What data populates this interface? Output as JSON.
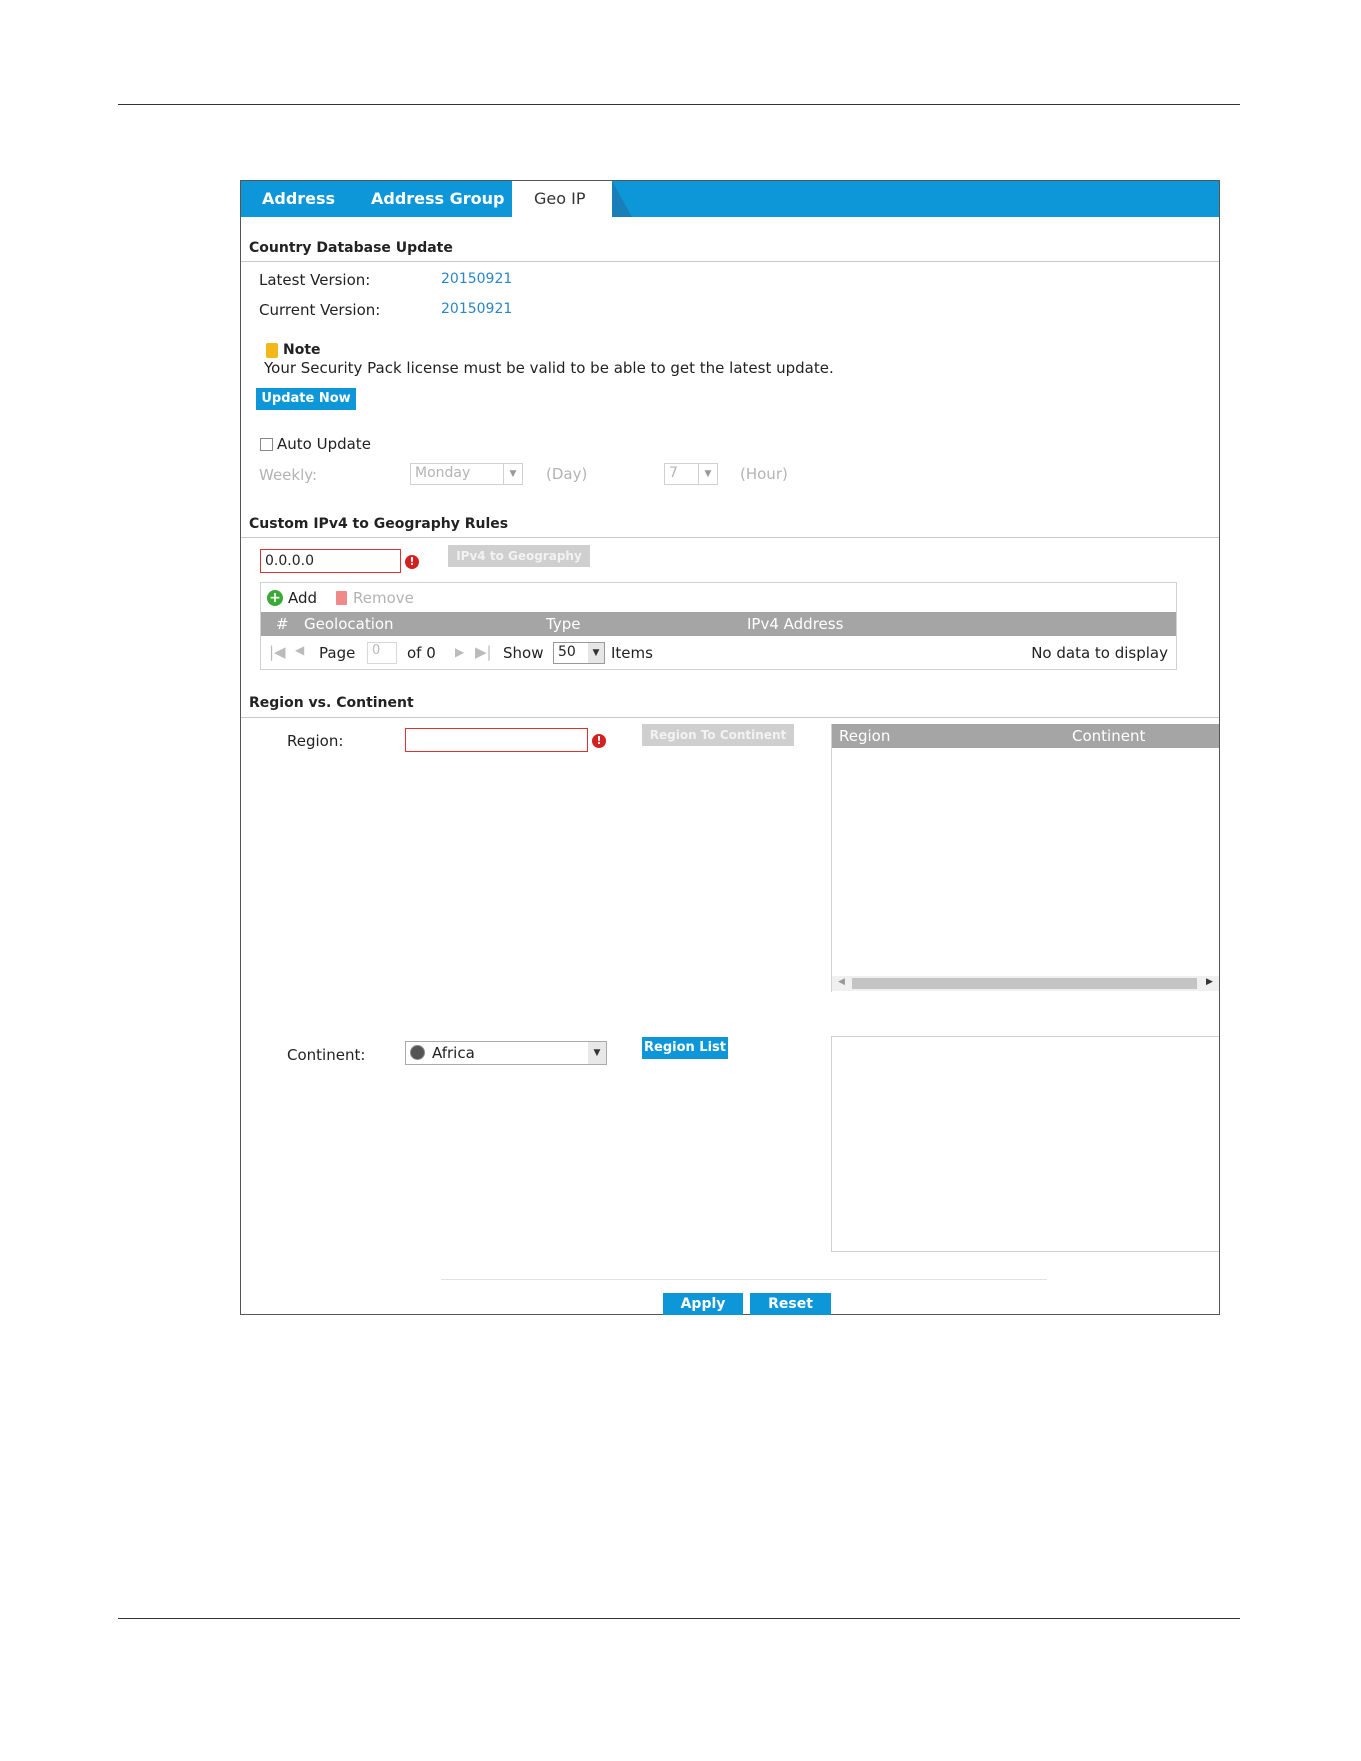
{
  "tabs": [
    {
      "label": "Address"
    },
    {
      "label": "Address Group"
    },
    {
      "label": "Geo IP"
    }
  ],
  "country_db": {
    "title": "Country Database Update",
    "latest_label": "Latest Version:",
    "latest_value": "20150921",
    "current_label": "Current Version:",
    "current_value": "20150921",
    "note_title": "Note",
    "note_text": "Your Security Pack license must be valid to be able to get the latest update.",
    "update_button": "Update Now",
    "auto_update_label": "Auto Update",
    "weekly_label": "Weekly:",
    "day_value": "Monday",
    "day_unit": "(Day)",
    "hour_value": "7",
    "hour_unit": "(Hour)"
  },
  "custom_rules": {
    "title": "Custom IPv4 to Geography Rules",
    "ip_value": "0.0.0.0",
    "ip_button": "IPv4 to Geography",
    "add_label": "Add",
    "remove_label": "Remove",
    "columns": [
      "#",
      "Geolocation",
      "Type",
      "IPv4 Address"
    ],
    "pager": {
      "page_label": "Page",
      "page_value": "0",
      "of_label": "of 0",
      "show_label": "Show",
      "show_value": "50",
      "items_label": "Items",
      "empty_text": "No data to display"
    }
  },
  "region_continent": {
    "title": "Region vs. Continent",
    "region_label": "Region:",
    "region_value": "",
    "region_button": "Region To Continent",
    "table_columns": [
      "Region",
      "Continent"
    ],
    "continent_label": "Continent:",
    "continent_value": "Africa",
    "region_list_button": "Region List"
  },
  "footer": {
    "apply": "Apply",
    "reset": "Reset"
  },
  "colors": {
    "accent": "#0d96d8",
    "error": "#d32020",
    "link": "#2a86c8",
    "grid_header": "#a5a5a5"
  }
}
